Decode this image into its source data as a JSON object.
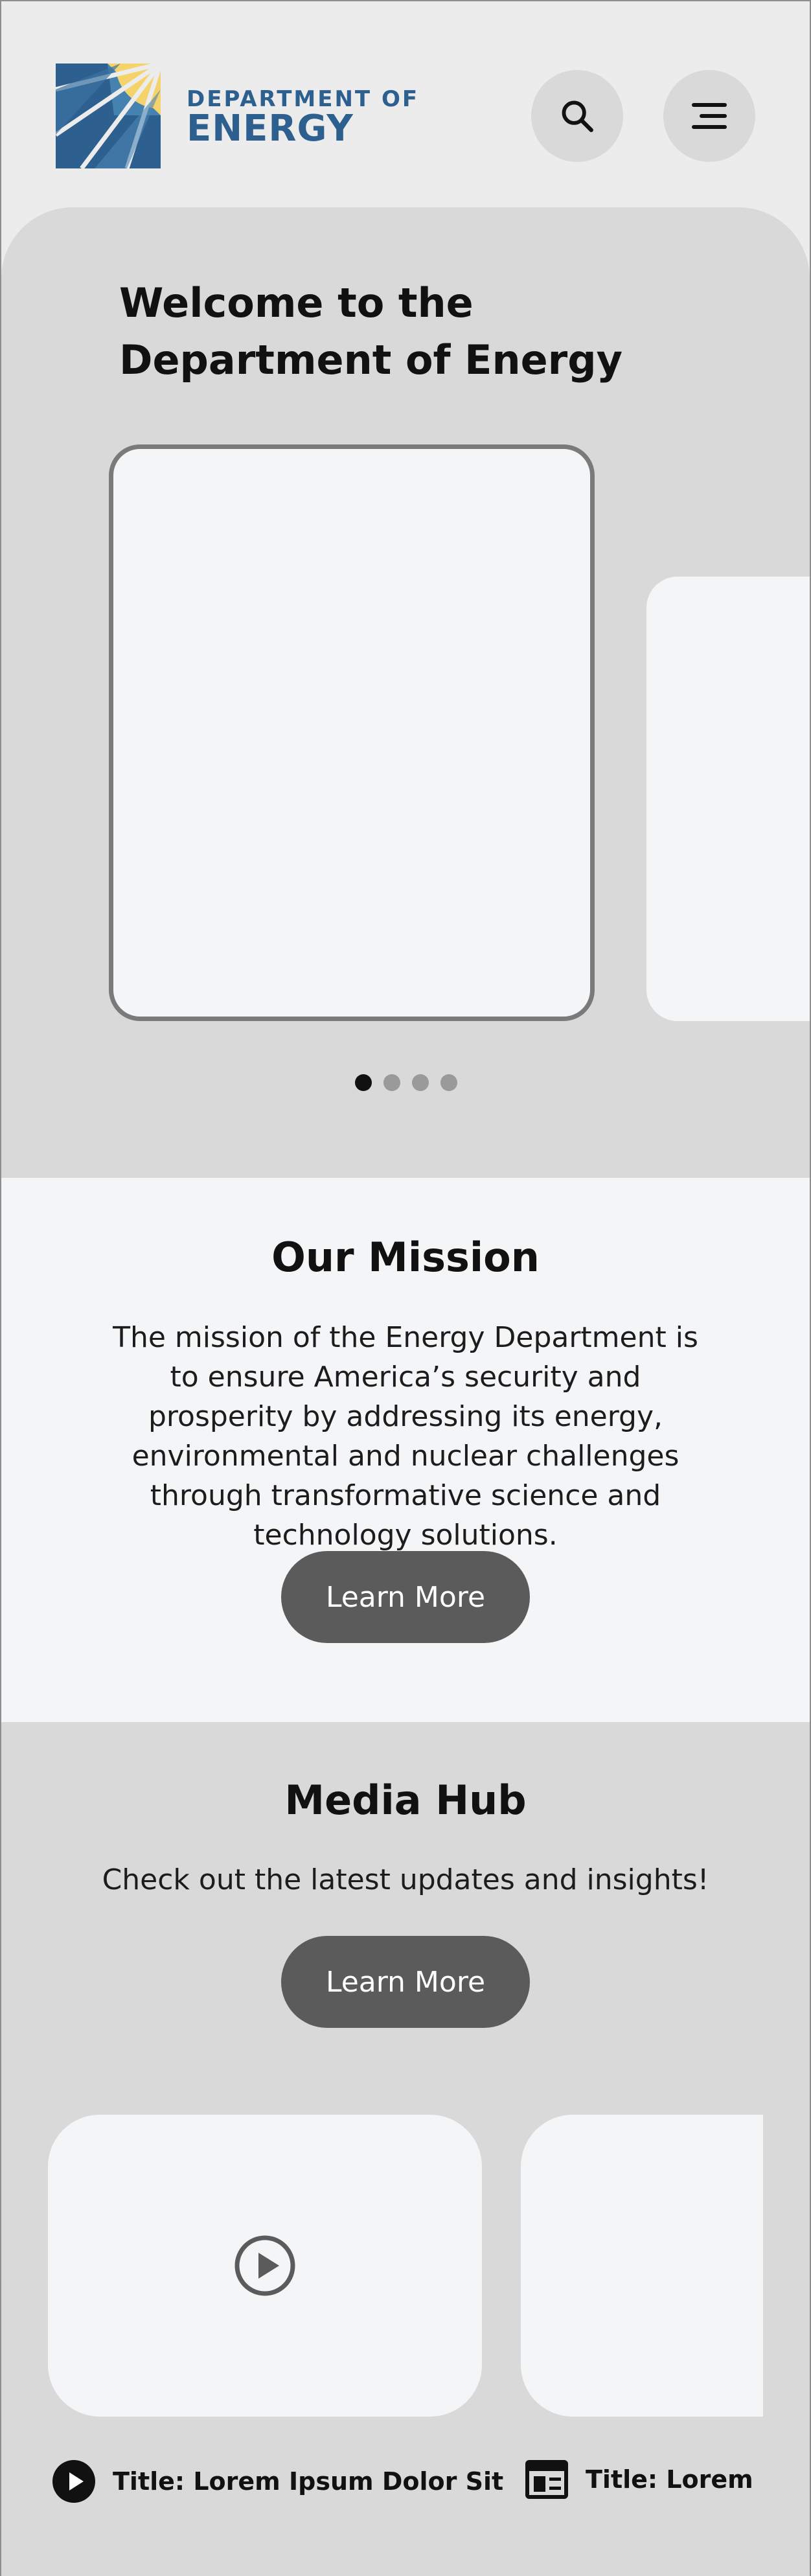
{
  "header": {
    "logo_line1": "DEPARTMENT OF",
    "logo_line2": "ENERGY",
    "search_icon": "search-icon",
    "menu_icon": "menu-icon"
  },
  "hero": {
    "title": "Welcome to the Department of Energy",
    "carousel_pages": 4,
    "active_page": 1
  },
  "mission": {
    "title": "Our Mission",
    "text": "The mission of the Energy Department is to ensure America’s security and prosperity by addressing its energy, environmental and nuclear challenges through transformative science and technology solutions.",
    "button": "Learn More"
  },
  "media_hub": {
    "title": "Media Hub",
    "subtitle": "Check out the latest updates and insights!",
    "button": "Learn More",
    "items": [
      {
        "title": "Title: Lorem Ipsum Dolor Sit",
        "icon": "play-icon"
      },
      {
        "title": "Title: Lorem Ipsum Dolor Sit",
        "icon": "article-icon"
      }
    ]
  },
  "colors": {
    "logo_blue": "#2d5f8f",
    "logo_yellow": "#f5d36b",
    "button": "#5b5b5b",
    "hero_bg": "#d9d9d9",
    "card_bg": "#f4f5f7"
  }
}
